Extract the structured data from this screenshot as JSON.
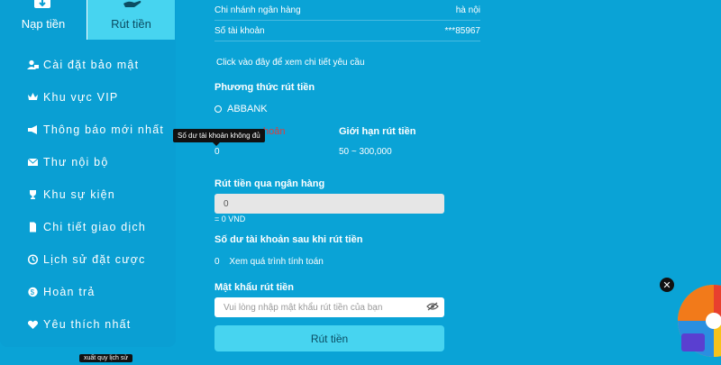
{
  "tabs": {
    "deposit": "Nạp tiền",
    "withdraw": "Rút tiền"
  },
  "menu": [
    {
      "label": "Cài đặt bảo mật",
      "icon": "user-lock-icon"
    },
    {
      "label": "Khu vực VIP",
      "icon": "crown-icon"
    },
    {
      "label": "Thông báo mới nhất",
      "icon": "megaphone-icon"
    },
    {
      "label": "Thư nội bộ",
      "icon": "envelope-icon"
    },
    {
      "label": "Khu sự kiện",
      "icon": "trophy-icon"
    },
    {
      "label": "Chi tiết giao dịch",
      "icon": "document-icon"
    },
    {
      "label": "Lịch sử đặt cược",
      "icon": "history-icon"
    },
    {
      "label": "Hoàn trả",
      "icon": "dollar-icon"
    },
    {
      "label": "Yêu thích nhất",
      "icon": "heart-icon"
    }
  ],
  "details": {
    "branch_label": "Chi nhánh ngân hàng",
    "branch_value": "hà nội",
    "account_label": "Số tài khoản",
    "account_value": "***85967",
    "details_link": "Click vào đây để xem chi tiết yêu cầu"
  },
  "method": {
    "heading": "Phương thức rút tiền",
    "option": "ABBANK"
  },
  "balance": {
    "label_partial": "hoản",
    "value": "0",
    "tooltip": "Số dư tài khoản không đủ"
  },
  "limit": {
    "label": "Giới hạn rút tiền",
    "value": "50 ~ 300,000"
  },
  "withdraw_bank": {
    "label": "Rút tiền qua ngân hàng",
    "input_value": "0",
    "converted": "= 0 VND"
  },
  "after": {
    "label": "Số dư tài khoản sau khi rút tiền",
    "value": "0",
    "calc_link": "Xem quá trình tính toán"
  },
  "password": {
    "label": "Mật khẩu rút tiền",
    "placeholder": "Vui lòng nhập mật khẩu rút tiền của bạn"
  },
  "submit_label": "Rút tiền",
  "close_glyph": "✕",
  "bottom_tip": "xuất quy lịch sử",
  "colors": {
    "background": "#0aa3d6",
    "tab_inactive": "#47d4f0",
    "warning_text": "#e23b3b"
  }
}
